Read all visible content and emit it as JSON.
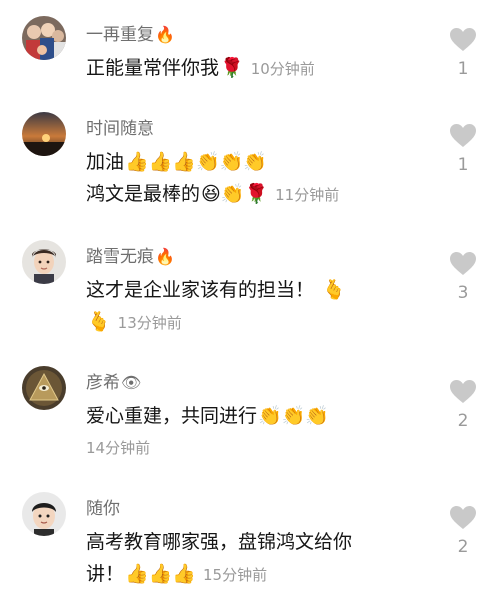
{
  "comments": [
    {
      "username": "一再重复",
      "name_emoji": "🔥",
      "lines": [
        {
          "text": "正能量常伴你我",
          "emojis": "🌹",
          "time": "10分钟前"
        }
      ],
      "likes": "1",
      "avatar": "group-photo"
    },
    {
      "username": "时间随意",
      "name_emoji": "",
      "lines": [
        {
          "text": "加油",
          "emojis": "👍👍👍👏👏👏",
          "time": ""
        },
        {
          "text": "鸿文是最棒的",
          "emojis": "😆👏🌹",
          "time": "11分钟前"
        }
      ],
      "likes": "1",
      "avatar": "sunset"
    },
    {
      "username": "踏雪无痕",
      "name_emoji": "🔥",
      "lines": [
        {
          "text": "这才是企业家该有的担当！",
          "emojis": "🫰",
          "time": ""
        }
      ],
      "time_line": {
        "emojis": "🫰",
        "time": "13分钟前"
      },
      "likes": "3",
      "avatar": "cartoon-man"
    },
    {
      "username": "彦希",
      "name_emoji": "👁",
      "lines": [
        {
          "text": "爱心重建，共同进行",
          "emojis": "👏👏👏",
          "time": ""
        }
      ],
      "time_line": {
        "emojis": "",
        "time": "14分钟前"
      },
      "likes": "2",
      "avatar": "pyramid"
    },
    {
      "username": "随你",
      "name_emoji": "",
      "lines": [
        {
          "text": "高考教育哪家强，盘锦鸿文给你",
          "emojis": "",
          "time": ""
        },
        {
          "text": "讲！",
          "emojis": "👍👍👍",
          "time": "15分钟前"
        }
      ],
      "likes": "2",
      "avatar": "cartoon-boy"
    }
  ]
}
